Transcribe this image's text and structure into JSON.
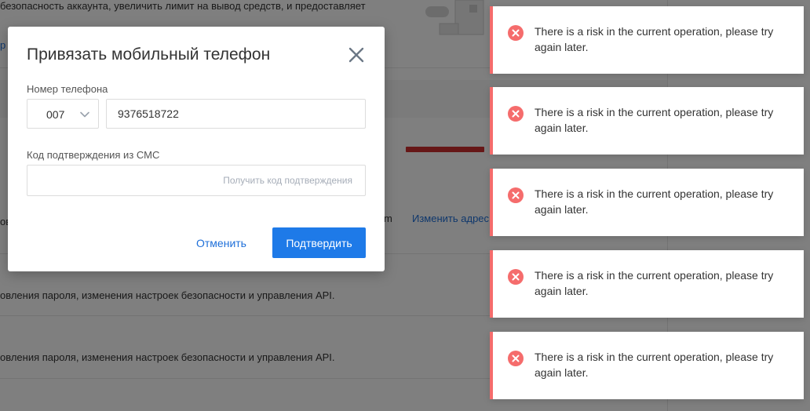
{
  "background": {
    "intro_text": "безопасность аккаунта, увеличить лимит на вывод средств, и предоставляет",
    "link_fragment": "р",
    "truncated_prefix": "ов",
    "truncated_m": "m",
    "change_email_link": "Изменить адрес э",
    "row1_text": "овления пароля, изменения настроек безопасности и управления API.",
    "row2_text": "овления пароля, изменения настроек безопасности и управления API."
  },
  "modal": {
    "title": "Привязать мобильный телефон",
    "phone_label": "Номер телефона",
    "country_code": "007",
    "phone_value": "9376518722",
    "sms_label": "Код подтверждения из СМС",
    "sms_value": "",
    "get_code_label": "Получить код подтверждения",
    "cancel_label": "Отменить",
    "confirm_label": "Подтвердить"
  },
  "toasts": [
    {
      "message": "There is a risk in the current operation, please try again later."
    },
    {
      "message": "There is a risk in the current operation, please try again later."
    },
    {
      "message": "There is a risk in the current operation, please try again later."
    },
    {
      "message": "There is a risk in the current operation, please try again later."
    },
    {
      "message": "There is a risk in the current operation, please try again later."
    }
  ],
  "icons": {
    "close": "close-icon",
    "chevron": "chevron-down-icon",
    "error": "error-circle-icon"
  },
  "colors": {
    "accent": "#1e7ae8",
    "link": "#1e6fd9",
    "error": "#f56c6c",
    "overlay": "rgba(0,0,0,0.5)"
  }
}
